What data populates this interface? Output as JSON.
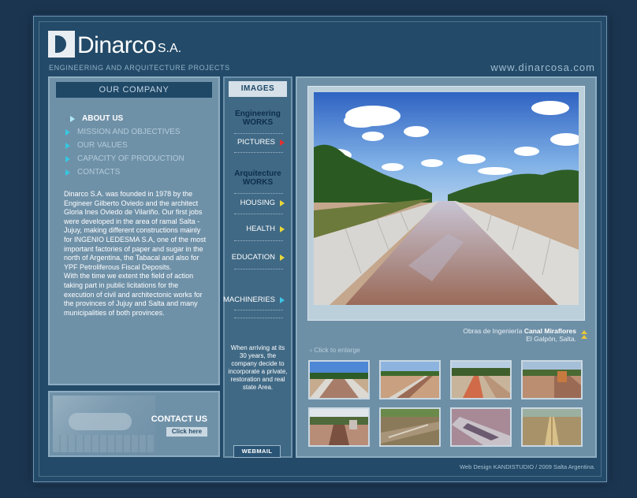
{
  "brand": {
    "name": "Dinarco",
    "suffix": "S.A.",
    "tagline": "ENGINEERING AND ARQUITECTURE PROJECTS",
    "url": "www.dinarcosa.com"
  },
  "left": {
    "header": "OUR COMPANY",
    "menu": [
      {
        "label": "ABOUT US",
        "active": true
      },
      {
        "label": "MISSION AND OBJECTIVES",
        "active": false
      },
      {
        "label": "OUR VALUES",
        "active": false
      },
      {
        "label": "CAPACITY OF PRODUCTION",
        "active": false
      },
      {
        "label": "CONTACTS",
        "active": false
      }
    ],
    "about_p1": "Dinarco S.A. was founded in 1978 by the Engineer Gilberto Oviedo and the architect Gloria Ines Oviedo de Vilariño. Our first jobs were developed in the area of ramal Salta - Jujuy, making different constructions mainly for INGENIO LEDESMA S.A, one of the most important factories of paper and sugar in the north of Argentina, the Tabacal and also for YPF Petroliferous Fiscal Deposits.",
    "about_p2": "With the time we extent the field of action taking part in public licitations for the execution of civil and architectonic works for the provinces of Jujuy and Salta and many municipalities of both provinces.",
    "contact_title": "CONTACT US",
    "contact_button": "Click here"
  },
  "mid": {
    "header": "IMAGES",
    "eng_line1": "Engineering",
    "eng_line2": "WORKS",
    "pictures": "PICTURES",
    "arq_line1": "Arquitecture",
    "arq_line2": "WORKS",
    "housing": "HOUSING",
    "health": "HEALTH",
    "education": "EDUCATION",
    "machineries": "MACHINERIES",
    "note": "When arriving at its 30 years, the company decide to incorporate a private, restoration and real state Area.",
    "webmail": "WEBMAIL"
  },
  "right": {
    "caption_prefix": "Obras de Ingeniería",
    "caption_name": "Canal Miraflores",
    "caption_place": "El Galpón, Salta.",
    "enlarge": "Click to enlarge"
  },
  "footer": "Web Design KANDISTUDIO / 2009 Salta Argentina."
}
